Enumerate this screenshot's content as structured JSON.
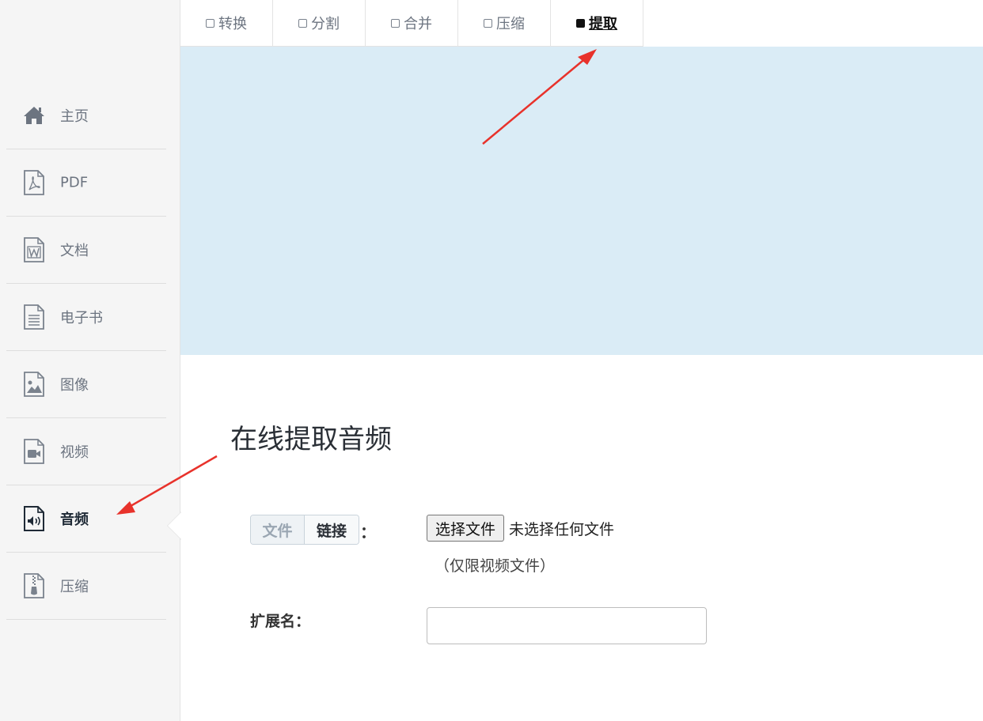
{
  "sidebar": {
    "items": [
      {
        "label": "主页",
        "icon": "home-icon"
      },
      {
        "label": "PDF",
        "icon": "pdf-file-icon"
      },
      {
        "label": "文档",
        "icon": "word-file-icon"
      },
      {
        "label": "电子书",
        "icon": "ebook-file-icon"
      },
      {
        "label": "图像",
        "icon": "image-file-icon"
      },
      {
        "label": "视频",
        "icon": "video-file-icon"
      },
      {
        "label": "音频",
        "icon": "audio-file-icon",
        "active": true
      },
      {
        "label": "压缩",
        "icon": "zip-file-icon"
      }
    ]
  },
  "tabs": [
    {
      "label": "转换"
    },
    {
      "label": "分割"
    },
    {
      "label": "合并"
    },
    {
      "label": "压缩"
    },
    {
      "label": "提取",
      "active": true
    }
  ],
  "main": {
    "title": "在线提取音频",
    "source_toggle": {
      "file_label": "文件",
      "link_label": "链接",
      "colon": "："
    },
    "file_input": {
      "button_label": "选择文件",
      "status": "未选择任何文件",
      "hint": "（仅限视频文件）"
    },
    "extension": {
      "label": "扩展名：",
      "value": ""
    }
  },
  "colors": {
    "banner": "#daecf6",
    "sidebar_bg": "#f5f5f5",
    "annotation_arrow": "#e8322b"
  }
}
